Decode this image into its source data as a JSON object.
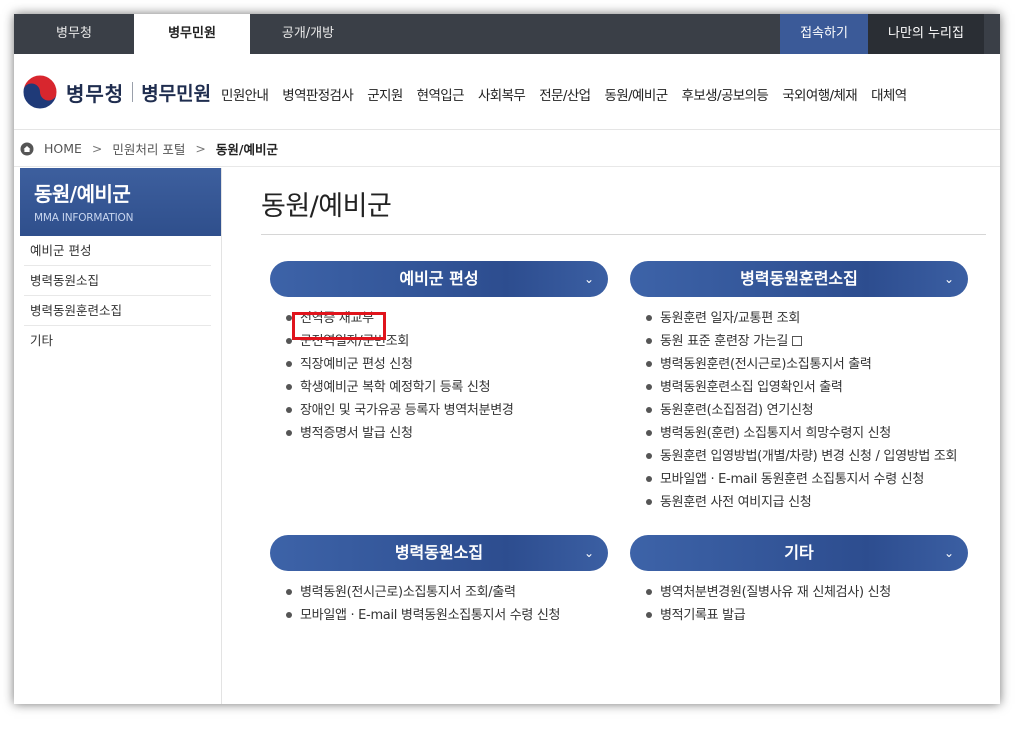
{
  "topbar": {
    "tabs": [
      "병무청",
      "병무민원",
      "공개/개방"
    ],
    "login": "접속하기",
    "my": "나만의 누리집"
  },
  "header": {
    "logo_text": "병무청",
    "logo_sub": "병무민원",
    "gnb": [
      "민원안내",
      "병역판정검사",
      "군지원",
      "현역입근",
      "사회복무",
      "전문/산업",
      "동원/예비군",
      "후보생/공보의등",
      "국외여행/체재",
      "대체역"
    ]
  },
  "breadcrumb": {
    "home": "HOME",
    "portal": "민원처리 포털",
    "current": "동원/예비군"
  },
  "sidebar": {
    "title": "동원/예비군",
    "subtitle": "MMA INFORMATION",
    "items": [
      "예비군 편성",
      "병력동원소집",
      "병력동원훈련소집",
      "기타"
    ]
  },
  "main": {
    "title": "동원/예비군",
    "panels": [
      {
        "title": "예비군 편성",
        "items": [
          "전역증 재교부",
          "군전역일자/군번조회",
          "직장예비군 편성 신청",
          "학생예비군 복학 예정학기 등록 신청",
          "장애인 및 국가유공 등록자 병역처분변경",
          "병적증명서 발급 신청"
        ]
      },
      {
        "title": "병력동원훈련소집",
        "items": [
          "동원훈련 일자/교통편 조회",
          "동원 표준 훈련장 가는길",
          "병력동원훈련(전시근로)소집통지서 출력",
          "병력동원훈련소집 입영확인서 출력",
          "동원훈련(소집점검) 연기신청",
          "병력동원(훈련) 소집통지서 희망수령지 신청",
          "동원훈련 입영방법(개별/차량) 변경 신청 / 입영방법 조회",
          "모바일앱 · E-mail 동원훈련 소집통지서 수령 신청",
          "동원훈련 사전 여비지급 신청"
        ]
      },
      {
        "title": "병력동원소집",
        "items": [
          "병력동원(전시근로)소집통지서 조회/출력",
          "모바일앱 · E-mail 병력동원소집통지서 수령 신청"
        ]
      },
      {
        "title": "기타",
        "items": [
          "병역처분변경원(질병사유 재 신체검사) 신청",
          "병적기록표 발급"
        ]
      }
    ]
  },
  "colors": {
    "accent": "#2d4d8f",
    "highlight": "#e0141c"
  }
}
